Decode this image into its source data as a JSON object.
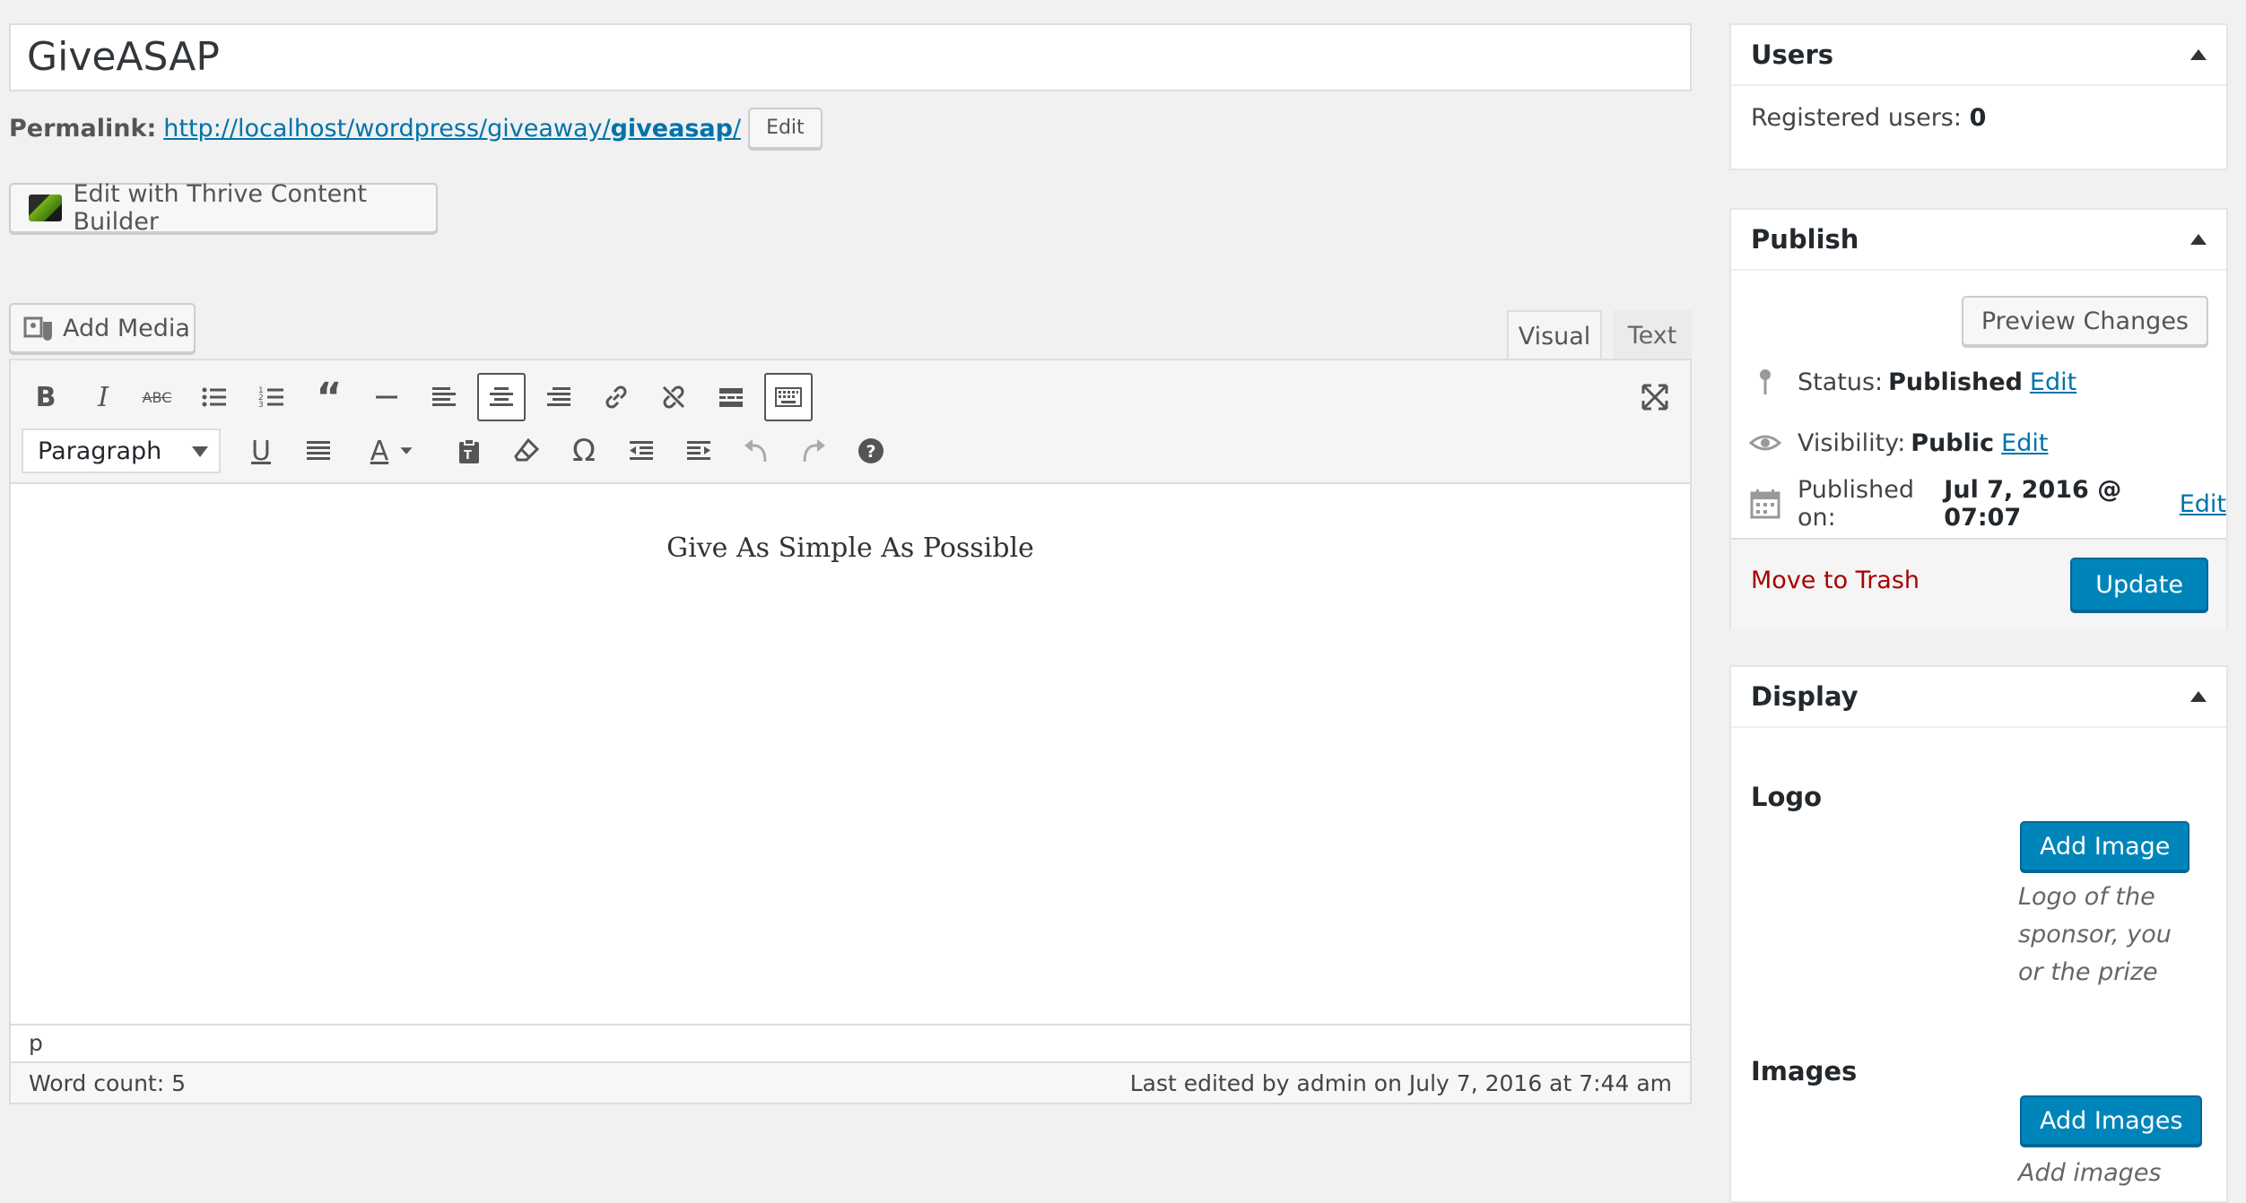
{
  "post": {
    "title": "GiveASAP",
    "permalink_label": "Permalink:",
    "permalink_base": "http://localhost/wordpress/giveaway/",
    "permalink_slug": "giveasap",
    "permalink_trailing": "/",
    "edit_label": "Edit",
    "thrive_button": "Edit with Thrive Content Builder"
  },
  "editor": {
    "add_media": "Add Media",
    "tab_visual": "Visual",
    "tab_text": "Text",
    "format_select": "Paragraph",
    "content": "Give As Simple As Possible",
    "path": "p",
    "word_count": "Word count: 5",
    "last_edited": "Last edited by admin on July 7, 2016 at 7:44 am"
  },
  "users_box": {
    "title": "Users",
    "registered_label": "Registered users:",
    "registered_value": "0"
  },
  "publish_box": {
    "title": "Publish",
    "preview": "Preview Changes",
    "status_label": "Status:",
    "status_value": "Published",
    "visibility_label": "Visibility:",
    "visibility_value": "Public",
    "published_label": "Published on:",
    "published_value": "Jul 7, 2016 @ 07:07",
    "edit": "Edit",
    "trash": "Move to Trash",
    "update": "Update"
  },
  "display_box": {
    "title": "Display",
    "logo_label": "Logo",
    "add_image": "Add Image",
    "logo_desc": "Logo of the sponsor, you or the prize",
    "images_label": "Images",
    "add_images": "Add Images",
    "images_desc": "Add images"
  },
  "colors": {
    "link": "#0073aa",
    "primary": "#0085ba",
    "trash": "#aa0000",
    "background": "#f1f1f1"
  }
}
